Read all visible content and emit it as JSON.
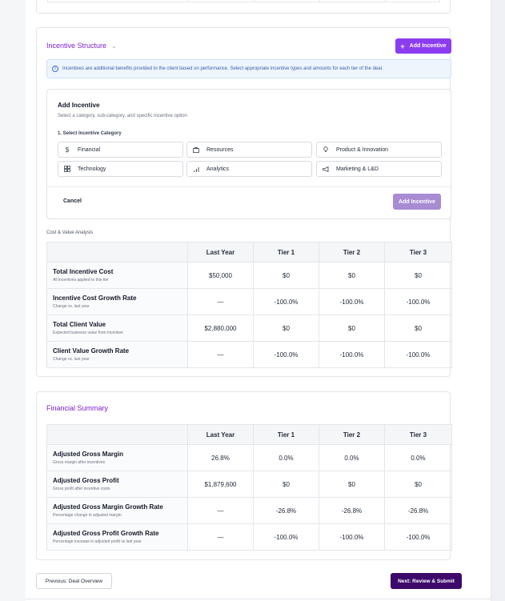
{
  "incentive_structure": {
    "title": "Incentive Structure",
    "add_button_label": "Add Incentive",
    "info_text": "Incentives are additional benefits provided to the client based on performance. Select appropriate incentive types and amounts for each tier of the deal.",
    "add_panel": {
      "title": "Add Incentive",
      "subtitle": "Select a category, sub-category, and specific incentive option",
      "step_label": "1. Select Incentive Category",
      "categories": [
        {
          "label": "Financial",
          "icon": "dollar-icon"
        },
        {
          "label": "Resources",
          "icon": "briefcase-icon"
        },
        {
          "label": "Product & Innovation",
          "icon": "lightbulb-icon"
        },
        {
          "label": "Technology",
          "icon": "grid-icon"
        },
        {
          "label": "Analytics",
          "icon": "bar-chart-icon"
        },
        {
          "label": "Marketing & L&D",
          "icon": "megaphone-icon"
        }
      ],
      "cancel_label": "Cancel",
      "submit_label": "Add Incentive"
    }
  },
  "cost_value": {
    "title": "Cost & Value Analysis",
    "columns": [
      "",
      "Last Year",
      "Tier 1",
      "Tier 2",
      "Tier 3"
    ],
    "rows": [
      {
        "label": "Total Incentive Cost",
        "sub": "All incentives applied to this tier",
        "values": [
          "$50,000",
          "$0",
          "$0",
          "$0"
        ],
        "tone": [
          "",
          "",
          "",
          ""
        ]
      },
      {
        "label": "Incentive Cost Growth Rate",
        "sub": "Change vs. last year",
        "values": [
          "—",
          "-100.0%",
          "-100.0%",
          "-100.0%"
        ],
        "tone": [
          "muted",
          "pos",
          "pos",
          "pos"
        ]
      },
      {
        "label": "Total Client Value",
        "sub": "Expected business value from incentive",
        "values": [
          "$2,880,000",
          "$0",
          "$0",
          "$0"
        ],
        "tone": [
          "",
          "",
          "",
          ""
        ]
      },
      {
        "label": "Client Value Growth Rate",
        "sub": "Change vs. last year",
        "values": [
          "—",
          "-100.0%",
          "-100.0%",
          "-100.0%"
        ],
        "tone": [
          "muted",
          "neg",
          "neg",
          "neg"
        ]
      }
    ]
  },
  "financial_summary": {
    "title": "Financial Summary",
    "columns": [
      "",
      "Last Year",
      "Tier 1",
      "Tier 2",
      "Tier 3"
    ],
    "rows": [
      {
        "label": "Adjusted Gross Margin",
        "sub": "Gross margin after incentives",
        "values": [
          "26.8%",
          "0.0%",
          "0.0%",
          "0.0%"
        ],
        "tone": [
          "",
          "",
          "",
          ""
        ]
      },
      {
        "label": "Adjusted Gross Profit",
        "sub": "Gross profit after incentive costs",
        "values": [
          "$1,879,600",
          "$0",
          "$0",
          "$0"
        ],
        "tone": [
          "",
          "",
          "",
          ""
        ]
      },
      {
        "label": "Adjusted Gross Margin Growth Rate",
        "sub": "Percentage change in adjusted margin",
        "values": [
          "—",
          "-26.8%",
          "-26.8%",
          "-26.8%"
        ],
        "tone": [
          "muted",
          "neg",
          "neg",
          "neg"
        ]
      },
      {
        "label": "Adjusted Gross Profit Growth Rate",
        "sub": "Percentage increase in adjusted profit vs last year",
        "values": [
          "—",
          "-100.0%",
          "-100.0%",
          "-100.0%"
        ],
        "tone": [
          "muted",
          "neg",
          "neg",
          "neg"
        ]
      }
    ]
  },
  "footer": {
    "prev_label": "Previous: Deal Overview",
    "next_label": "Next: Review & Submit"
  },
  "colors": {
    "accent": "#7e22ce",
    "button_purple": "#8b3cf0",
    "button_disabled": "#a88bd2",
    "next_button": "#3d0a6b"
  }
}
